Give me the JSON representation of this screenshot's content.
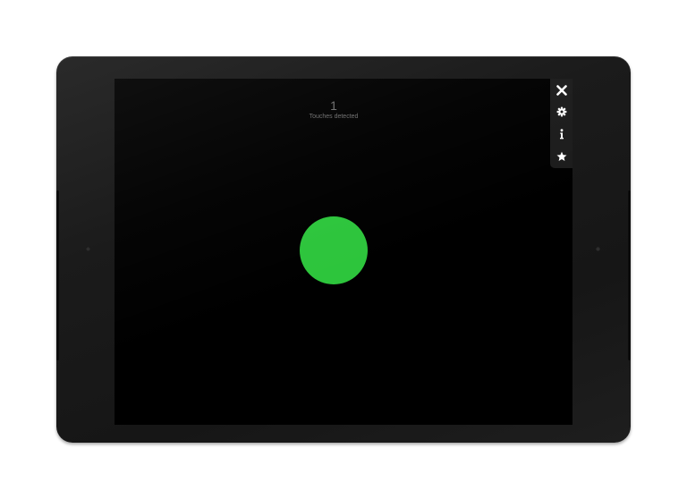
{
  "touch_counter": {
    "count": "1",
    "label": "Touches detected"
  },
  "touch_points": [
    {
      "color": "#2dc53c"
    }
  ],
  "toolbar": {
    "items": [
      {
        "icon": "close-icon"
      },
      {
        "icon": "gear-icon"
      },
      {
        "icon": "info-icon"
      },
      {
        "icon": "star-icon"
      }
    ]
  },
  "colors": {
    "screen": "#000000",
    "bezel": "#1e1e1e",
    "counter_text": "#6f6f6f",
    "toolbar_bg": "#1c1c1c",
    "toolbar_icon": "#ffffff"
  }
}
